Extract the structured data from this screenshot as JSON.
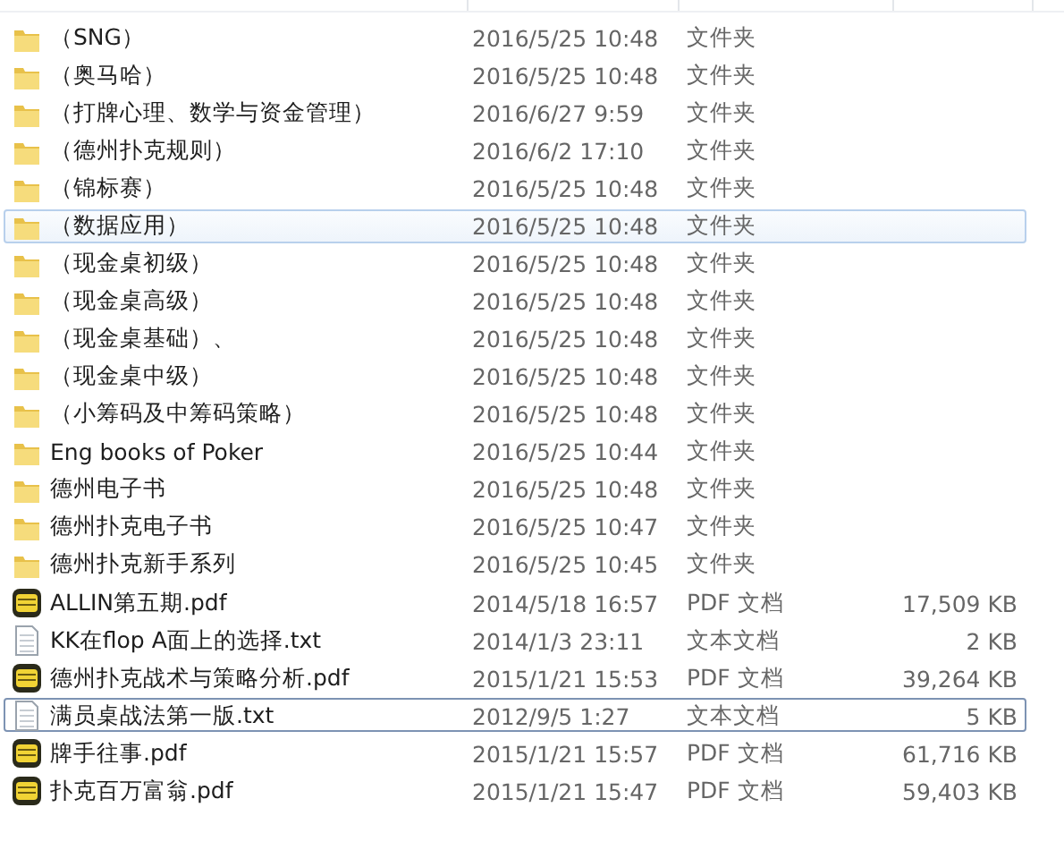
{
  "files": [
    {
      "kind": "folder",
      "name": "（SNG）",
      "modified": "2016/5/25 10:48",
      "type": "文件夹",
      "selected": false,
      "focused": false
    },
    {
      "kind": "folder",
      "name": "（奥马哈）",
      "modified": "2016/5/25 10:48",
      "type": "文件夹",
      "selected": false,
      "focused": false
    },
    {
      "kind": "folder",
      "name": "（打牌心理、数学与资金管理）",
      "modified": "2016/6/27 9:59",
      "type": "文件夹",
      "selected": false,
      "focused": false
    },
    {
      "kind": "folder",
      "name": "（德州扑克规则）",
      "modified": "2016/6/2 17:10",
      "type": "文件夹",
      "selected": false,
      "focused": false
    },
    {
      "kind": "folder",
      "name": "（锦标赛）",
      "modified": "2016/5/25 10:48",
      "type": "文件夹",
      "selected": false,
      "focused": false
    },
    {
      "kind": "folder",
      "name": "（数据应用）",
      "modified": "2016/5/25 10:48",
      "type": "文件夹",
      "selected": true,
      "focused": false
    },
    {
      "kind": "folder",
      "name": "（现金桌初级）",
      "modified": "2016/5/25 10:48",
      "type": "文件夹",
      "selected": false,
      "focused": false
    },
    {
      "kind": "folder",
      "name": "（现金桌高级）",
      "modified": "2016/5/25 10:48",
      "type": "文件夹",
      "selected": false,
      "focused": false
    },
    {
      "kind": "folder",
      "name": "（现金桌基础）、",
      "modified": "2016/5/25 10:48",
      "type": "文件夹",
      "selected": false,
      "focused": false
    },
    {
      "kind": "folder",
      "name": "（现金桌中级）",
      "modified": "2016/5/25 10:48",
      "type": "文件夹",
      "selected": false,
      "focused": false
    },
    {
      "kind": "folder",
      "name": "（小筹码及中筹码策略）",
      "modified": "2016/5/25 10:48",
      "type": "文件夹",
      "selected": false,
      "focused": false
    },
    {
      "kind": "folder",
      "name": "Eng books of Poker",
      "modified": "2016/5/25 10:44",
      "type": "文件夹",
      "selected": false,
      "focused": false
    },
    {
      "kind": "folder",
      "name": "德州电子书",
      "modified": "2016/5/25 10:48",
      "type": "文件夹",
      "selected": false,
      "focused": false
    },
    {
      "kind": "folder",
      "name": "德州扑克电子书",
      "modified": "2016/5/25 10:47",
      "type": "文件夹",
      "selected": false,
      "focused": false
    },
    {
      "kind": "folder",
      "name": "德州扑克新手系列",
      "modified": "2016/5/25 10:45",
      "type": "文件夹",
      "selected": false,
      "focused": false
    },
    {
      "kind": "pdf",
      "name": "ALLIN第五期.pdf",
      "modified": "2014/5/18 16:57",
      "type": "PDF 文档",
      "size": "17,509 KB",
      "selected": false,
      "focused": false
    },
    {
      "kind": "txt",
      "name": "KK在flop A面上的选择.txt",
      "modified": "2014/1/3 23:11",
      "type": "文本文档",
      "size": "2 KB",
      "selected": false,
      "focused": false
    },
    {
      "kind": "pdf",
      "name": "德州扑克战术与策略分析.pdf",
      "modified": "2015/1/21 15:53",
      "type": "PDF 文档",
      "size": "39,264 KB",
      "selected": false,
      "focused": false
    },
    {
      "kind": "txt",
      "name": "满员桌战法第一版.txt",
      "modified": "2012/9/5 1:27",
      "type": "文本文档",
      "size": "5 KB",
      "selected": false,
      "focused": true
    },
    {
      "kind": "pdf",
      "name": "牌手往事.pdf",
      "modified": "2015/1/21 15:57",
      "type": "PDF 文档",
      "size": "61,716 KB",
      "selected": false,
      "focused": false
    },
    {
      "kind": "pdf",
      "name": "扑克百万富翁.pdf",
      "modified": "2015/1/21 15:47",
      "type": "PDF 文档",
      "size": "59,403 KB",
      "selected": false,
      "focused": false
    }
  ]
}
